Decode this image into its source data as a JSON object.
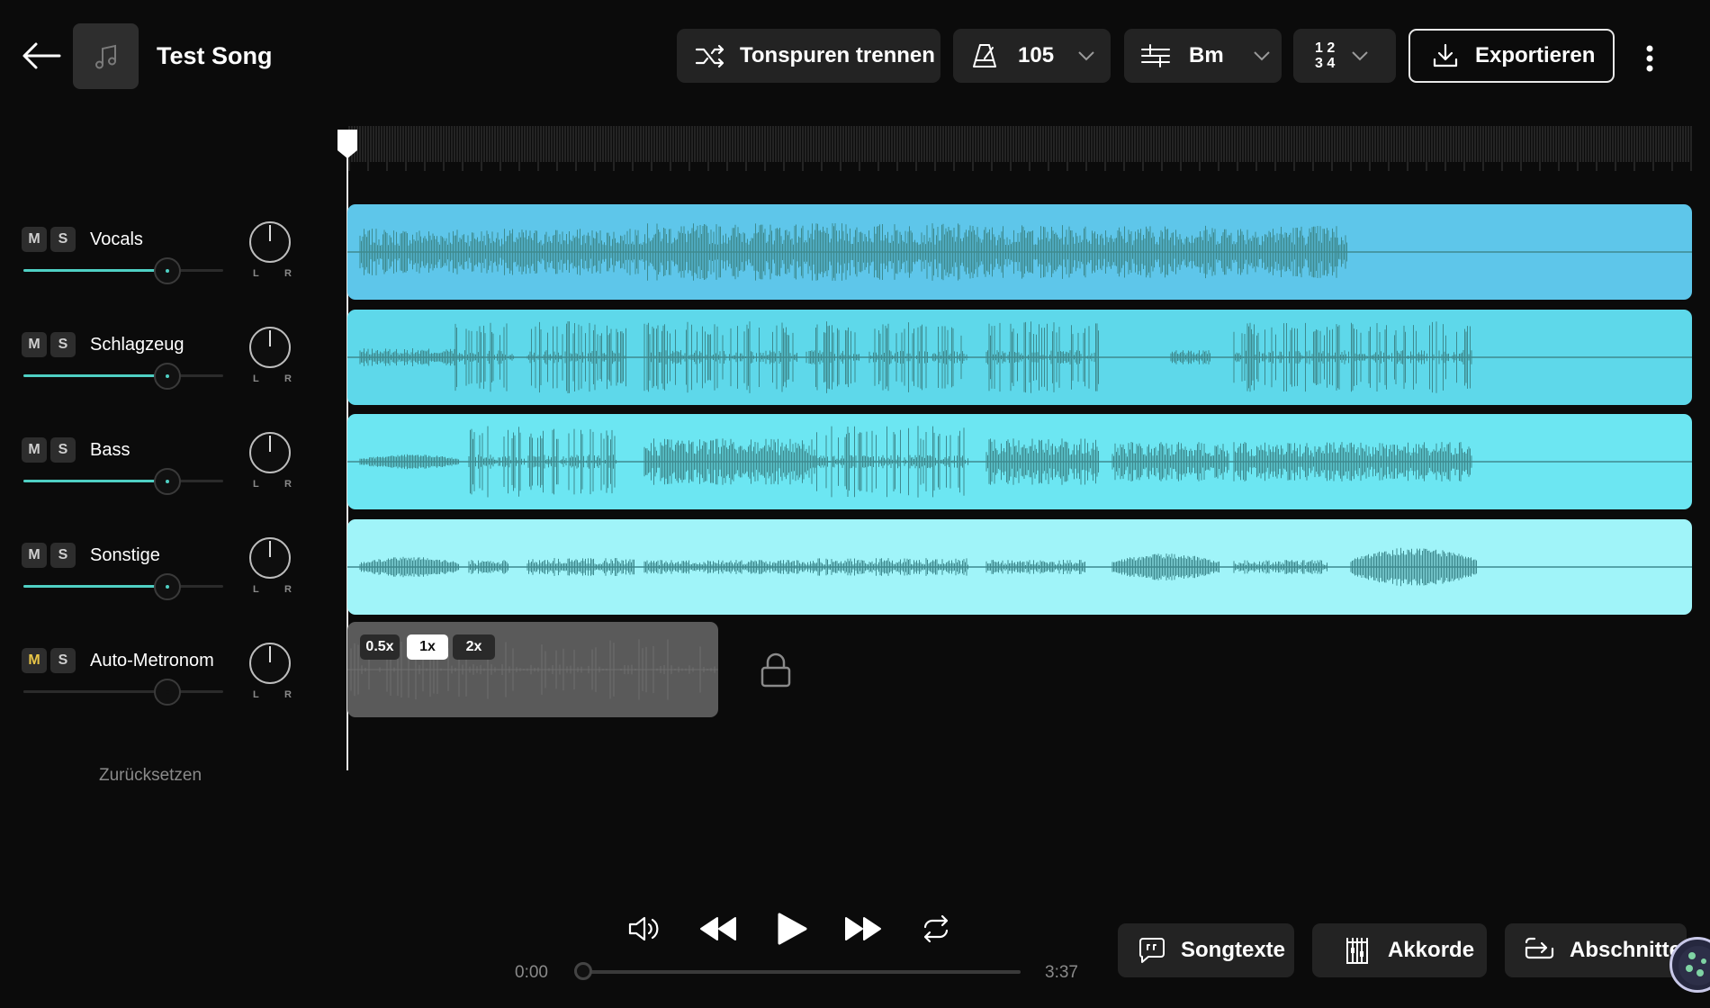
{
  "header": {
    "title": "Test Song",
    "separate_label": "Tonspuren trennen",
    "tempo_value": "105",
    "key_value": "Bm",
    "time_signature_top": "1 2",
    "time_signature_bottom": "3 4",
    "export_label": "Exportieren"
  },
  "tracks": [
    {
      "name": "Vocals",
      "mute": "M",
      "solo": "S",
      "pan_left": "L",
      "pan_right": "R",
      "color": "#5ec6ea",
      "volume": 0.72
    },
    {
      "name": "Schlagzeug",
      "mute": "M",
      "solo": "S",
      "pan_left": "L",
      "pan_right": "R",
      "color": "#5ed8ea",
      "volume": 0.72
    },
    {
      "name": "Bass",
      "mute": "M",
      "solo": "S",
      "pan_left": "L",
      "pan_right": "R",
      "color": "#6ce6f2",
      "volume": 0.72
    },
    {
      "name": "Sonstige",
      "mute": "M",
      "solo": "S",
      "pan_left": "L",
      "pan_right": "R",
      "color": "#a0f4f9",
      "volume": 0.72
    },
    {
      "name": "Auto-Metronom",
      "mute": "M",
      "solo": "S",
      "pan_left": "L",
      "pan_right": "R",
      "color": "#5a5a5a",
      "volume": 0.72,
      "mute_active_color": "#e8c547"
    }
  ],
  "metronome": {
    "speeds": [
      "0.5x",
      "1x",
      "2x"
    ],
    "selected_speed": "1x"
  },
  "reset_label": "Zurücksetzen",
  "transport": {
    "current_time": "0:00",
    "total_time": "3:37",
    "progress": 0.0
  },
  "bottom": {
    "lyrics_label": "Songtexte",
    "chords_label": "Akkorde",
    "sections_label": "Abschnitte"
  },
  "icons": [
    "back-arrow-icon",
    "music-note-icon",
    "split-arrows-icon",
    "metronome-icon",
    "key-sliders-icon",
    "chevron-down-icon",
    "download-icon",
    "more-vertical-icon",
    "lock-icon",
    "volume-icon",
    "rewind-icon",
    "play-icon",
    "fast-forward-icon",
    "loop-icon",
    "lyrics-bubble-icon",
    "chords-grid-icon",
    "section-loop-icon",
    "cookie-icon"
  ],
  "colors": {
    "background": "#0b0b0b",
    "waveform": "#3e8a8f",
    "slider_active": "#4fd0c4",
    "button_bg": "#232323"
  }
}
